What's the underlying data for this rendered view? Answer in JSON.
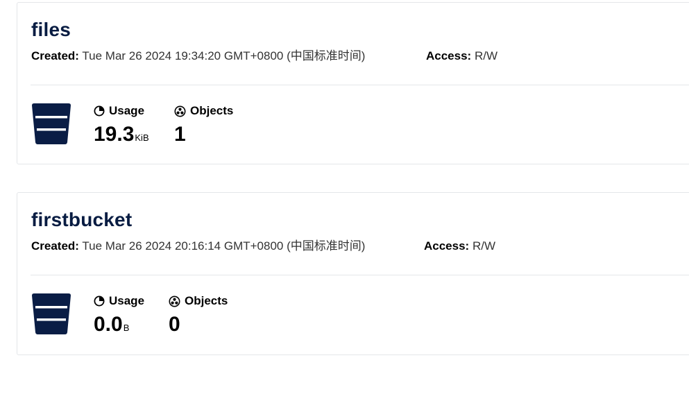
{
  "colors": {
    "bucket_name": "#081c42",
    "icon": "#0a1d45",
    "divider": "#e4e6e9"
  },
  "labels": {
    "created": "Created:",
    "access": "Access:",
    "usage": "Usage",
    "objects": "Objects"
  },
  "buckets": [
    {
      "name": "files",
      "created": "Tue Mar 26 2024 19:34:20 GMT+0800 (中国标准时间)",
      "access": "R/W",
      "usage_value": "19.3",
      "usage_unit": "KiB",
      "objects": "1",
      "icon": "bucket-icon"
    },
    {
      "name": "firstbucket",
      "created": "Tue Mar 26 2024 20:16:14 GMT+0800 (中国标准时间)",
      "access": "R/W",
      "usage_value": "0.0",
      "usage_unit": "B",
      "objects": "0",
      "icon": "bucket-icon"
    }
  ]
}
